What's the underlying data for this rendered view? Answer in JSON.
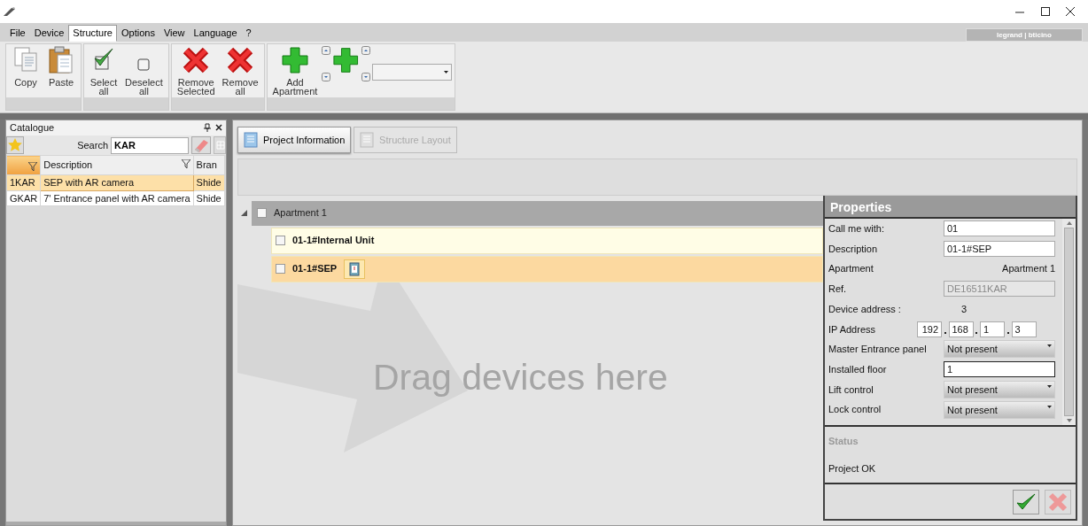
{
  "brand_logo": "legrand | bticino",
  "menu": [
    {
      "label": "File",
      "selected": false
    },
    {
      "label": "Device",
      "selected": false
    },
    {
      "label": "Structure",
      "selected": true
    },
    {
      "label": "Options",
      "selected": false
    },
    {
      "label": "View",
      "selected": false
    },
    {
      "label": "Language",
      "selected": false
    },
    {
      "label": "?",
      "selected": false
    }
  ],
  "ribbon_groups": [
    {
      "buttons": [
        {
          "label": "Copy",
          "kind": "copy"
        },
        {
          "label": "Paste",
          "kind": "paste"
        }
      ]
    },
    {
      "buttons": [
        {
          "label": "Select\nall",
          "kind": "check"
        },
        {
          "label": "Deselect\nall",
          "kind": "checkbox"
        }
      ]
    },
    {
      "buttons": [
        {
          "label": "Remove\nSelected",
          "kind": "remove"
        },
        {
          "label": "Remove\nall",
          "kind": "remove"
        }
      ]
    },
    {
      "buttons": [
        {
          "label": "Add\nApartment",
          "kind": "add"
        }
      ],
      "has_extra_add": true
    }
  ],
  "catalogue": {
    "title": "Catalogue",
    "search_label": "Search",
    "search_value": "KAR",
    "columns": [
      "",
      "Description",
      "Bran"
    ],
    "rows": [
      {
        "cells": [
          "1KAR",
          "SEP with AR camera",
          "Shide"
        ],
        "selected": true
      },
      {
        "cells": [
          "GKAR",
          "7' Entrance panel with AR camera",
          "Shide"
        ],
        "selected": false
      }
    ]
  },
  "view_tabs": [
    {
      "label": "Project Information",
      "selected": true,
      "disabled": false
    },
    {
      "label": "Structure Layout",
      "selected": false,
      "disabled": true
    }
  ],
  "tree": [
    {
      "label": "Apartment 1",
      "expanded": true,
      "checked": false,
      "children": [
        {
          "label": "01-1#Internal Unit",
          "checked": false,
          "selected": false,
          "has_badge": false
        },
        {
          "label": "01-1#SEP",
          "checked": false,
          "selected": true,
          "has_badge": true
        }
      ]
    }
  ],
  "drop_hint": "Drag devices here",
  "properties": {
    "title": "Properties",
    "rows": [
      {
        "kind": "input",
        "label": "Call me with:",
        "value": "01",
        "focused": false
      },
      {
        "kind": "input",
        "label": "Description",
        "value": "01-1#SEP",
        "focused": false
      },
      {
        "kind": "text",
        "label": "Apartment",
        "value": "Apartment 1"
      },
      {
        "kind": "readonly",
        "label": "Ref.",
        "value": "DE16511KAR"
      },
      {
        "kind": "value",
        "label": "Device address :",
        "value": "3"
      },
      {
        "kind": "ip",
        "label": "IP Address",
        "parts": [
          "192",
          "168",
          "1",
          "3"
        ]
      },
      {
        "kind": "select",
        "label": "Master Entrance panel",
        "value": "Not present"
      },
      {
        "kind": "input",
        "label": "Installed floor",
        "value": "1",
        "focused": true
      },
      {
        "kind": "select",
        "label": "Lift control",
        "value": "Not present"
      },
      {
        "kind": "select",
        "label": "Lock control",
        "value": "Not present"
      }
    ]
  },
  "status": {
    "title": "Status",
    "message": "Project OK"
  }
}
